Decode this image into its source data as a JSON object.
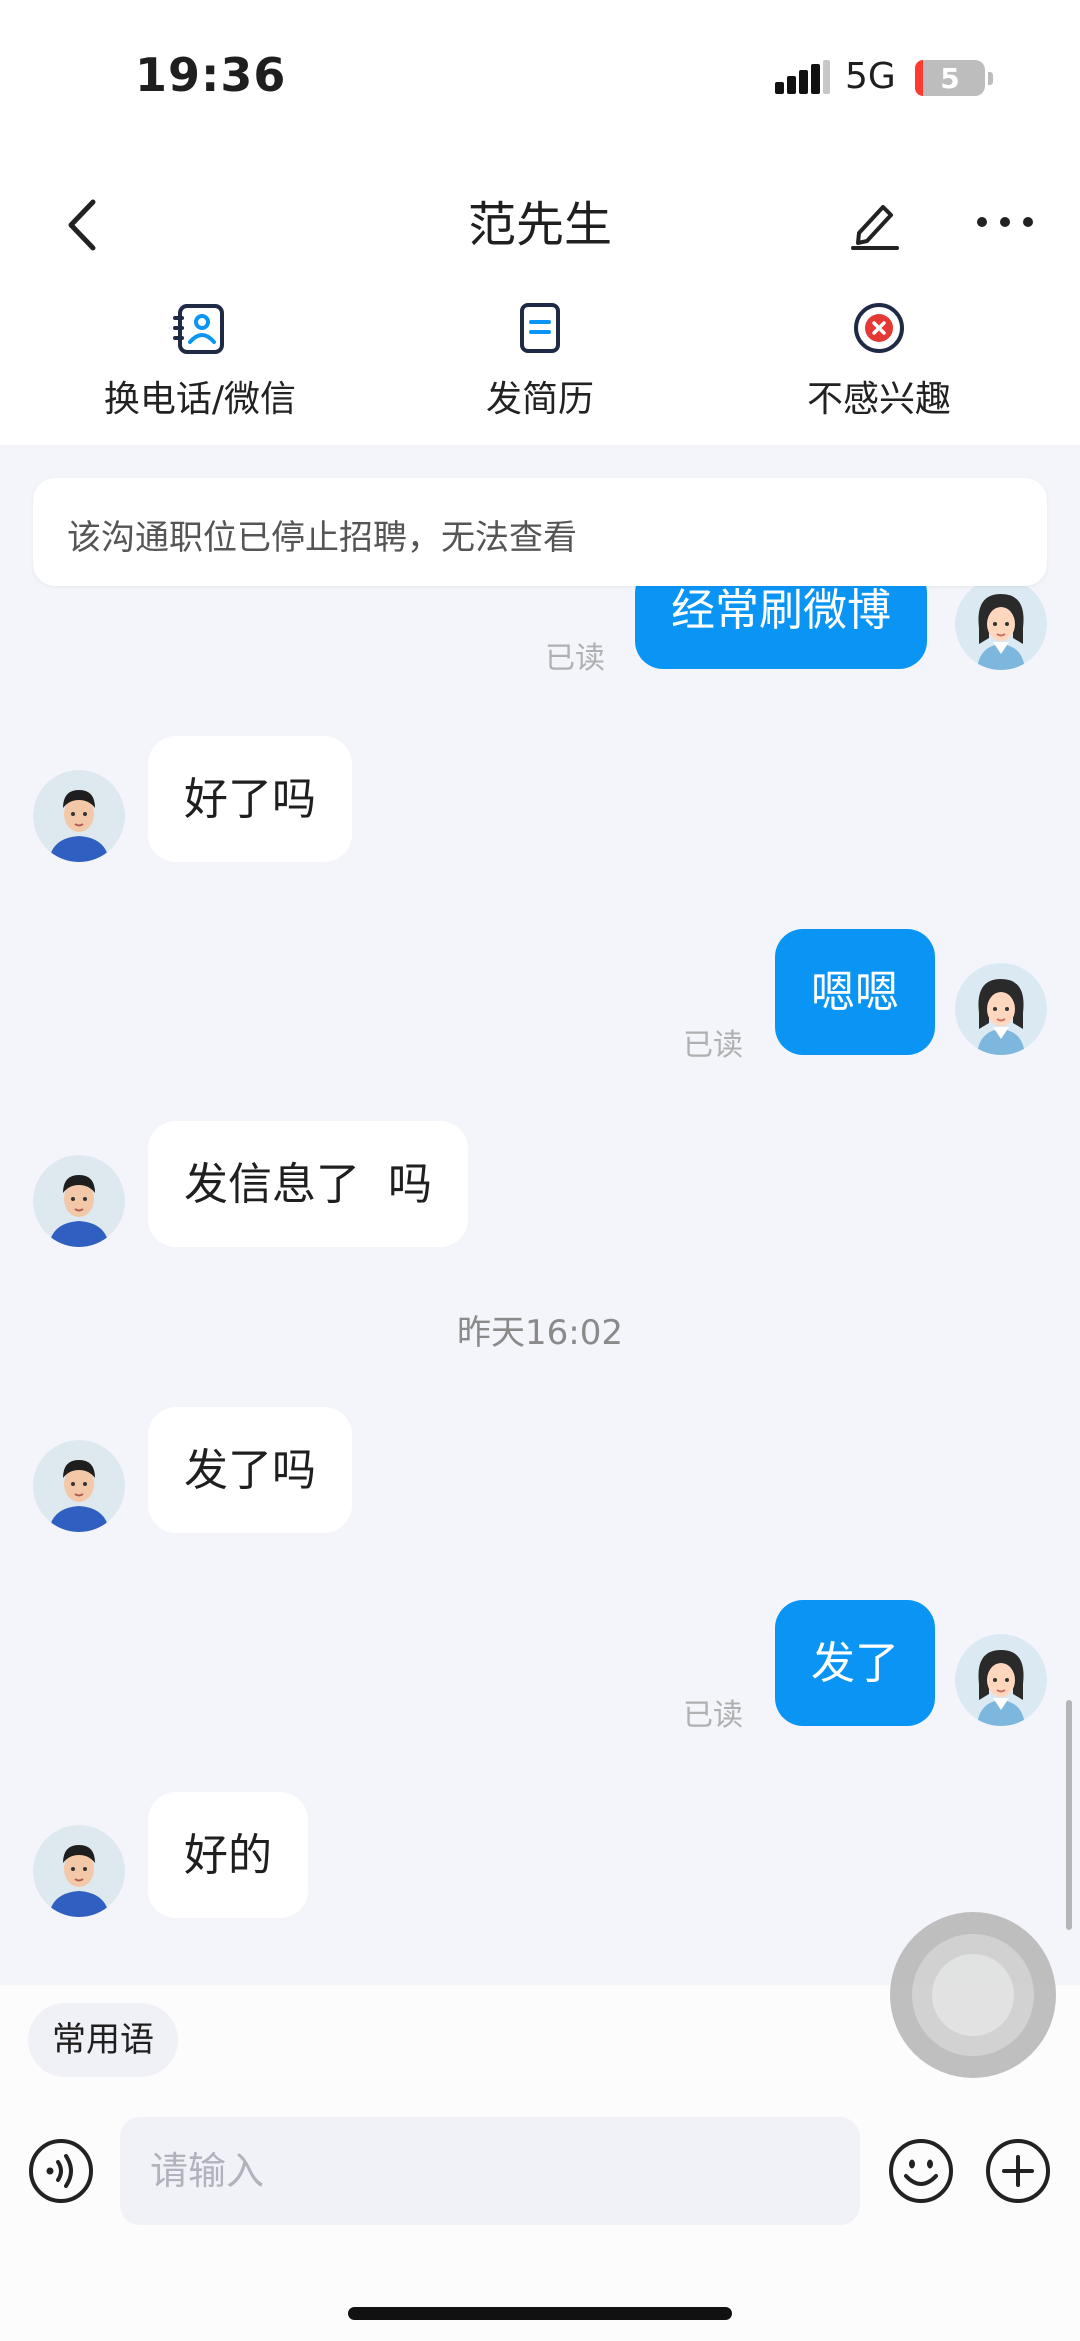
{
  "status_bar": {
    "time": "19:36",
    "network": "5G",
    "battery": "5"
  },
  "header": {
    "title": "范先生"
  },
  "actions": [
    {
      "label": "换电话/微信",
      "icon": "contact-card-icon"
    },
    {
      "label": "发简历",
      "icon": "resume-doc-icon"
    },
    {
      "label": "不感兴趣",
      "icon": "not-interested-icon"
    }
  ],
  "notice": "该沟通职位已停止招聘，无法查看",
  "messages": [
    {
      "from": "me",
      "text": "经常刷微博",
      "read": "已读"
    },
    {
      "from": "other",
      "text": "好了吗"
    },
    {
      "from": "me",
      "text": "嗯嗯",
      "read": "已读"
    },
    {
      "from": "other",
      "text": "发信息了  吗"
    },
    {
      "from": "other",
      "text": "发了吗"
    },
    {
      "from": "me",
      "text": "发了",
      "read": "已读"
    },
    {
      "from": "other",
      "text": "好的"
    }
  ],
  "timestamp": "昨天16:02",
  "composer": {
    "quick_phrases": "常用语",
    "placeholder": "请输入"
  },
  "colors": {
    "accent": "#0a95f5",
    "background": "#f3f5fb",
    "reject": "#e53935"
  }
}
